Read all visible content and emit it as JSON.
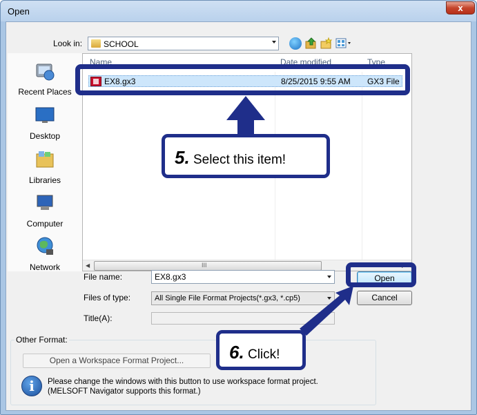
{
  "window": {
    "title": "Open",
    "close_label": "x"
  },
  "toolbar": {
    "lookin_label": "Look in:",
    "lookin_value": "SCHOOL"
  },
  "sidebar": {
    "items": [
      {
        "label": "Recent Places",
        "icon": "recent-places-icon"
      },
      {
        "label": "Desktop",
        "icon": "desktop-icon"
      },
      {
        "label": "Libraries",
        "icon": "libraries-icon"
      },
      {
        "label": "Computer",
        "icon": "computer-icon"
      },
      {
        "label": "Network",
        "icon": "network-icon"
      }
    ]
  },
  "filelist": {
    "columns": [
      "Name",
      "Date modified",
      "Type"
    ],
    "rows": [
      {
        "name": "EX8.gx3",
        "date": "8/25/2015 9:55 AM",
        "type": "GX3 File"
      }
    ],
    "scroll_glyph": "III"
  },
  "form": {
    "filename_label": "File name:",
    "filename_value": "EX8.gx3",
    "filetype_label": "Files of type:",
    "filetype_value": "All Single File Format Projects(*.gx3, *.cp5)",
    "title_label": "Title(A):"
  },
  "buttons": {
    "open": "Open",
    "cancel": "Cancel"
  },
  "other_format": {
    "legend": "Other Format:",
    "ws_button": "Open a Workspace Format Project...",
    "info_line1": "Please change the windows with this button to use workspace format project.",
    "info_line2": "(MELSOFT Navigator supports this format.)"
  },
  "callouts": {
    "step5_number": "5.",
    "step5_text": "Select this item!",
    "step6_number": "6.",
    "step6_text": "Click!"
  },
  "colors": {
    "callout_border": "#1f2e8a",
    "selection": "#cde6fb",
    "file_icon": "#c8102e"
  }
}
